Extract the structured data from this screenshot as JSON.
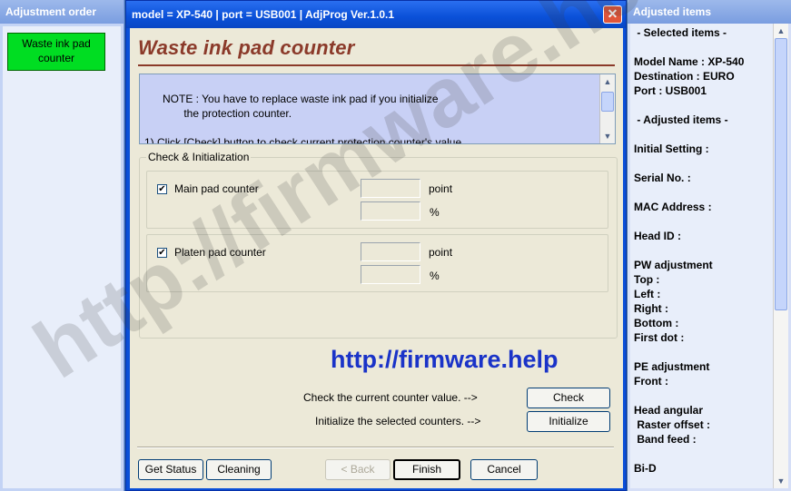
{
  "left_panel": {
    "header": "Adjustment order",
    "items": [
      "Waste ink pad\ncounter"
    ]
  },
  "window": {
    "title": "model = XP-540  |  port = USB001  |  AdjProg Ver.1.0.1",
    "close": "✕",
    "page_title": "Waste ink pad counter",
    "note": "NOTE : You have to replace waste ink pad if you initialize\n             the protection counter.\n\n1) Click [Check] button to check current protection counter's value.",
    "group_label": "Check & Initialization",
    "counters": [
      {
        "label": "Main pad counter",
        "checked": true,
        "point_value": "",
        "percent_value": "",
        "point_unit": "point",
        "percent_unit": "%"
      },
      {
        "label": "Platen pad counter",
        "checked": true,
        "point_value": "",
        "percent_value": "",
        "point_unit": "point",
        "percent_unit": "%"
      }
    ],
    "url_text": "http://firmware.help",
    "check_prompt": "Check the current counter value.  -->",
    "check_button": "Check",
    "init_prompt": "Initialize the selected counters.  -->",
    "init_button": "Initialize",
    "bottom_buttons": {
      "get_status": "Get Status",
      "cleaning": "Cleaning",
      "back": "< Back",
      "finish": "Finish",
      "cancel": "Cancel"
    }
  },
  "right_panel": {
    "header": "Adjusted items",
    "content": " - Selected items -\n\nModel Name : XP-540\nDestination : EURO\nPort : USB001\n\n - Adjusted items -\n\nInitial Setting :\n\nSerial No. :\n\nMAC Address :\n\nHead ID :\n\nPW adjustment\nTop :\nLeft :\nRight :\nBottom :\nFirst dot :\n\nPE adjustment\nFront :\n\nHead angular\n Raster offset :\n Band feed :\n\nBi-D"
  },
  "watermark": "http://firmware.help",
  "colors": {
    "title_color": "#8b3a2a",
    "url_color": "#1a33c8",
    "active_item": "#00dd22",
    "note_bg": "#c8d0f5"
  }
}
